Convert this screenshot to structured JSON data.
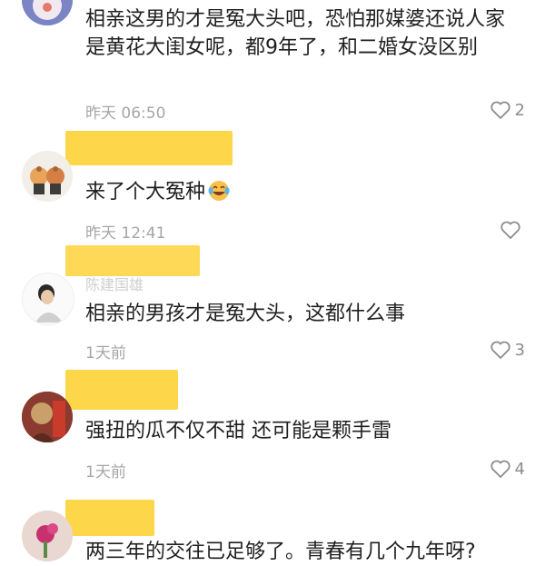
{
  "comments": [
    {
      "username": "",
      "text": "相亲这男的才是冤大头吧，恐怕那媒婆还说人家是黄花大闺女呢，都9年了，和二婚女没区别",
      "time": "昨天 06:50",
      "likes": "2"
    },
    {
      "username": "",
      "text": "来了个大冤种",
      "emoji": "laughing-crying-emoji",
      "time": "昨天 12:41",
      "likes": ""
    },
    {
      "username": "陈建国雄",
      "text": "相亲的男孩才是冤大头，这都什么事",
      "time": "1天前",
      "likes": "3"
    },
    {
      "username": "",
      "text": "强扭的瓜不仅不甜 还可能是颗手雷",
      "time": "1天前",
      "likes": "4"
    },
    {
      "username": "",
      "text": "两三年的交往已足够了。青春有几个九年呀?",
      "time": "",
      "likes": ""
    }
  ],
  "colors": {
    "mask": "#fdd23a",
    "text": "#1f1f1f",
    "meta": "#a6a6a6"
  }
}
